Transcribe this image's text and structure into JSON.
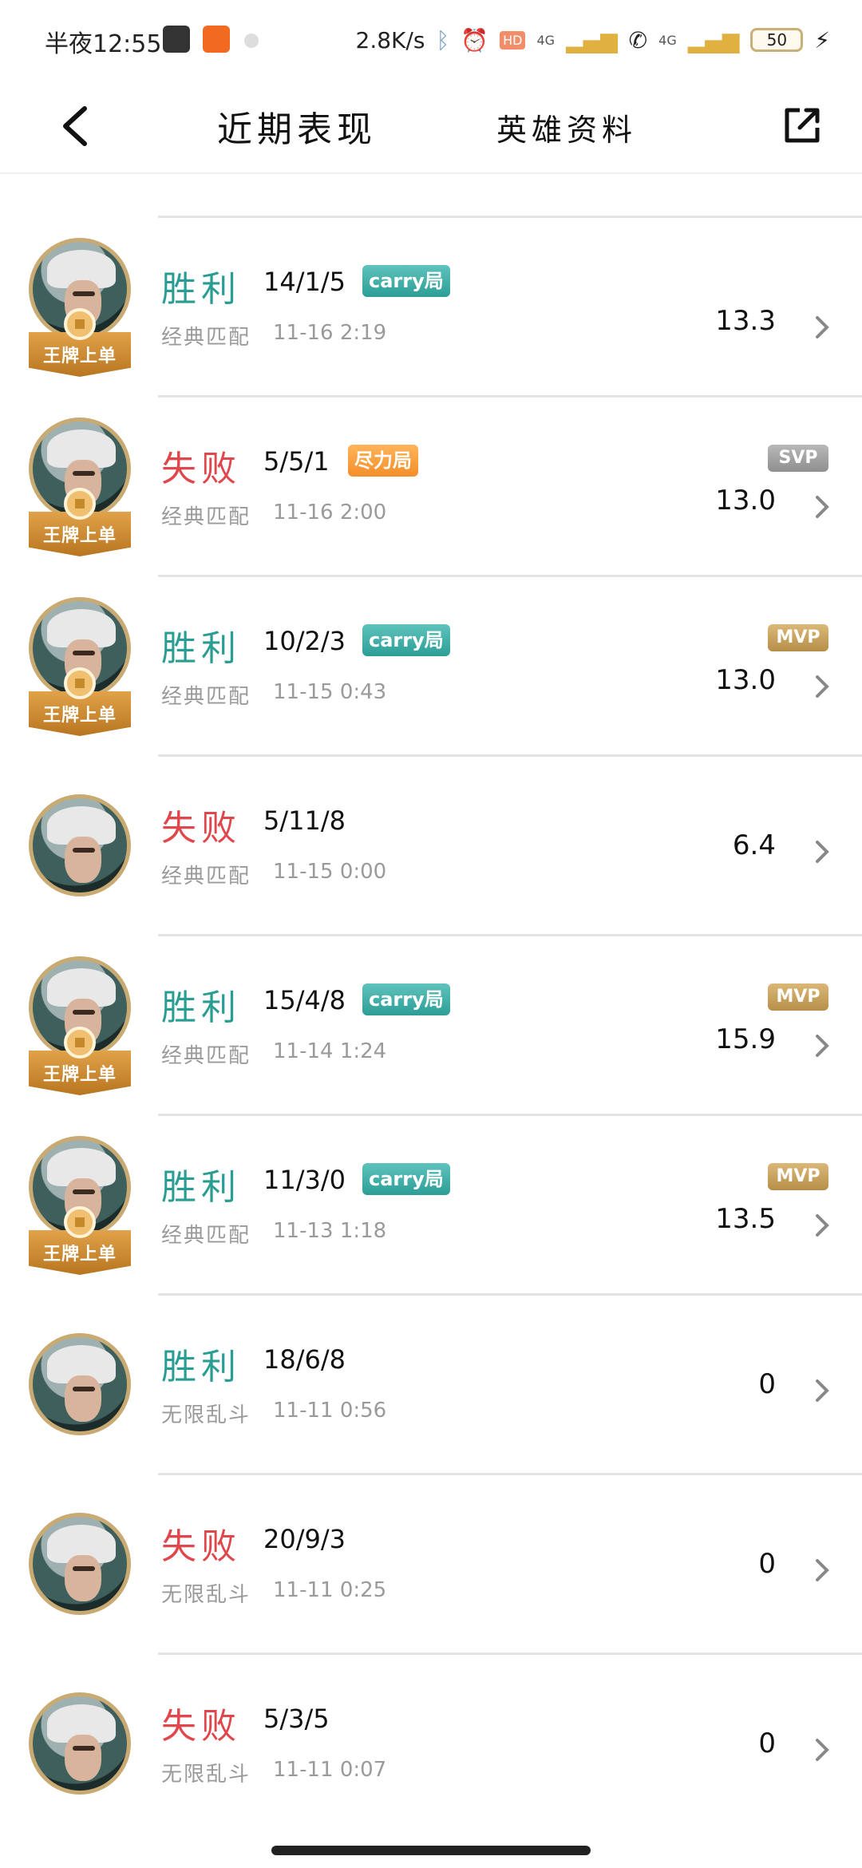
{
  "status": {
    "time": "半夜12:55",
    "net_speed": "2.8K/s",
    "net1": "4G",
    "net2": "4G",
    "battery": "50"
  },
  "header": {
    "tab_recent": "近期表现",
    "tab_hero": "英雄资料"
  },
  "ribbon_text": "王牌上单",
  "matches": [
    {
      "result": "胜利",
      "kda": "14/1/5",
      "tag": "carry局",
      "mode": "经典匹配",
      "time": "11-16 2:19",
      "badge": "",
      "score": "13.3"
    },
    {
      "result": "失败",
      "kda": "5/5/1",
      "tag": "尽力局",
      "mode": "经典匹配",
      "time": "11-16 2:00",
      "badge": "SVP",
      "score": "13.0"
    },
    {
      "result": "胜利",
      "kda": "10/2/3",
      "tag": "carry局",
      "mode": "经典匹配",
      "time": "11-15 0:43",
      "badge": "MVP",
      "score": "13.0"
    },
    {
      "result": "失败",
      "kda": "5/11/8",
      "tag": "",
      "mode": "经典匹配",
      "time": "11-15 0:00",
      "badge": "",
      "score": "6.4"
    },
    {
      "result": "胜利",
      "kda": "15/4/8",
      "tag": "carry局",
      "mode": "经典匹配",
      "time": "11-14 1:24",
      "badge": "MVP",
      "score": "15.9"
    },
    {
      "result": "胜利",
      "kda": "11/3/0",
      "tag": "carry局",
      "mode": "经典匹配",
      "time": "11-13 1:18",
      "badge": "MVP",
      "score": "13.5"
    },
    {
      "result": "胜利",
      "kda": "18/6/8",
      "tag": "",
      "mode": "无限乱斗",
      "time": "11-11 0:56",
      "badge": "",
      "score": "0"
    },
    {
      "result": "失败",
      "kda": "20/9/3",
      "tag": "",
      "mode": "无限乱斗",
      "time": "11-11 0:25",
      "badge": "",
      "score": "0"
    },
    {
      "result": "失败",
      "kda": "5/3/5",
      "tag": "",
      "mode": "无限乱斗",
      "time": "11-11 0:07",
      "badge": "",
      "score": "0"
    }
  ]
}
